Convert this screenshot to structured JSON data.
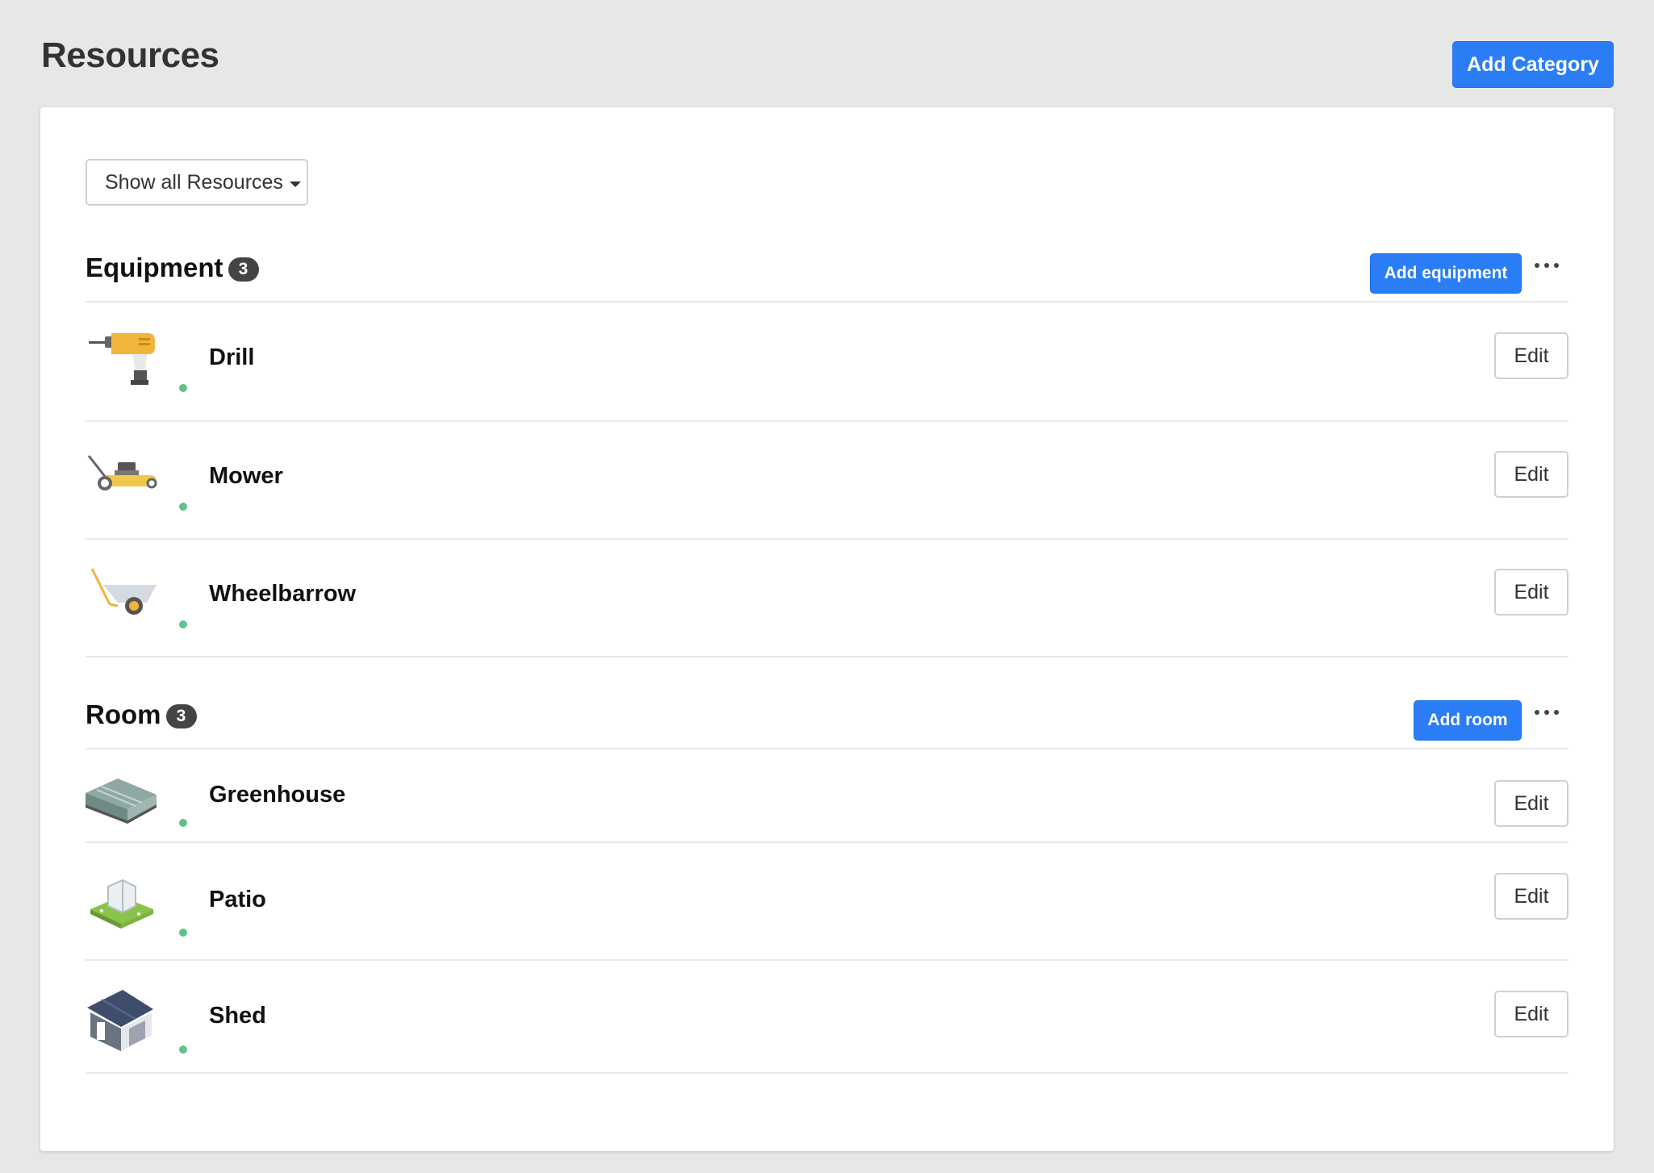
{
  "page": {
    "title": "Resources",
    "add_category_label": "Add Category"
  },
  "filter": {
    "label": "Show all Resources"
  },
  "sections": [
    {
      "title": "Equipment",
      "count": "3",
      "add_label": "Add equipment",
      "items": [
        {
          "name": "Drill",
          "icon": "drill-icon",
          "status": "active",
          "edit_label": "Edit"
        },
        {
          "name": "Mower",
          "icon": "mower-icon",
          "status": "active",
          "edit_label": "Edit"
        },
        {
          "name": "Wheelbarrow",
          "icon": "wheelbarrow-icon",
          "status": "active",
          "edit_label": "Edit"
        }
      ]
    },
    {
      "title": "Room",
      "count": "3",
      "add_label": "Add room",
      "items": [
        {
          "name": "Greenhouse",
          "icon": "greenhouse-icon",
          "status": "active",
          "edit_label": "Edit"
        },
        {
          "name": "Patio",
          "icon": "patio-icon",
          "status": "active",
          "edit_label": "Edit"
        },
        {
          "name": "Shed",
          "icon": "shed-icon",
          "status": "active",
          "edit_label": "Edit"
        }
      ]
    }
  ],
  "colors": {
    "primary": "#2b7df5",
    "status_active": "#5fc28b",
    "badge": "#444444",
    "page_bg": "#e6e8e8"
  }
}
